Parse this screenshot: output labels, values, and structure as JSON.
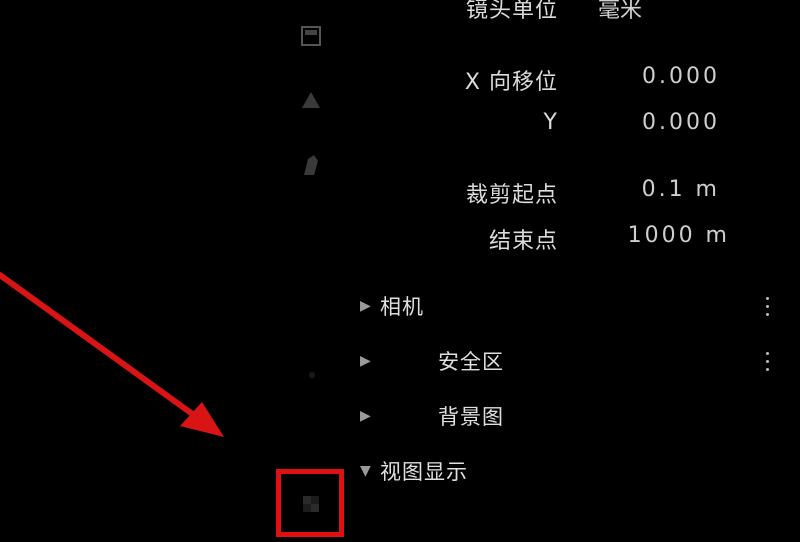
{
  "properties": {
    "unit_label": "镜头单位",
    "unit_value": "毫米",
    "x_shift_label": "X 向移位",
    "x_shift_value": "0.000",
    "y_shift_label": "Y",
    "y_shift_value": "0.000",
    "clip_start_label": "裁剪起点",
    "clip_start_value": "0.1 m",
    "clip_end_label": "结束点",
    "clip_end_value": "1000 m"
  },
  "panels": {
    "camera": "相机",
    "safe_areas": "安全区",
    "background_images": "背景图",
    "viewport_display": "视图显示"
  },
  "icons": {
    "tool_1": "object-properties-icon",
    "tool_2": "constraints-icon",
    "tool_3": "object-data-camera-icon",
    "highlighted": "texture-icon",
    "menu": "vertical-dots-icon"
  },
  "colors": {
    "background": "#000000",
    "highlight": "#e01010",
    "text": "#dcdcdc"
  }
}
